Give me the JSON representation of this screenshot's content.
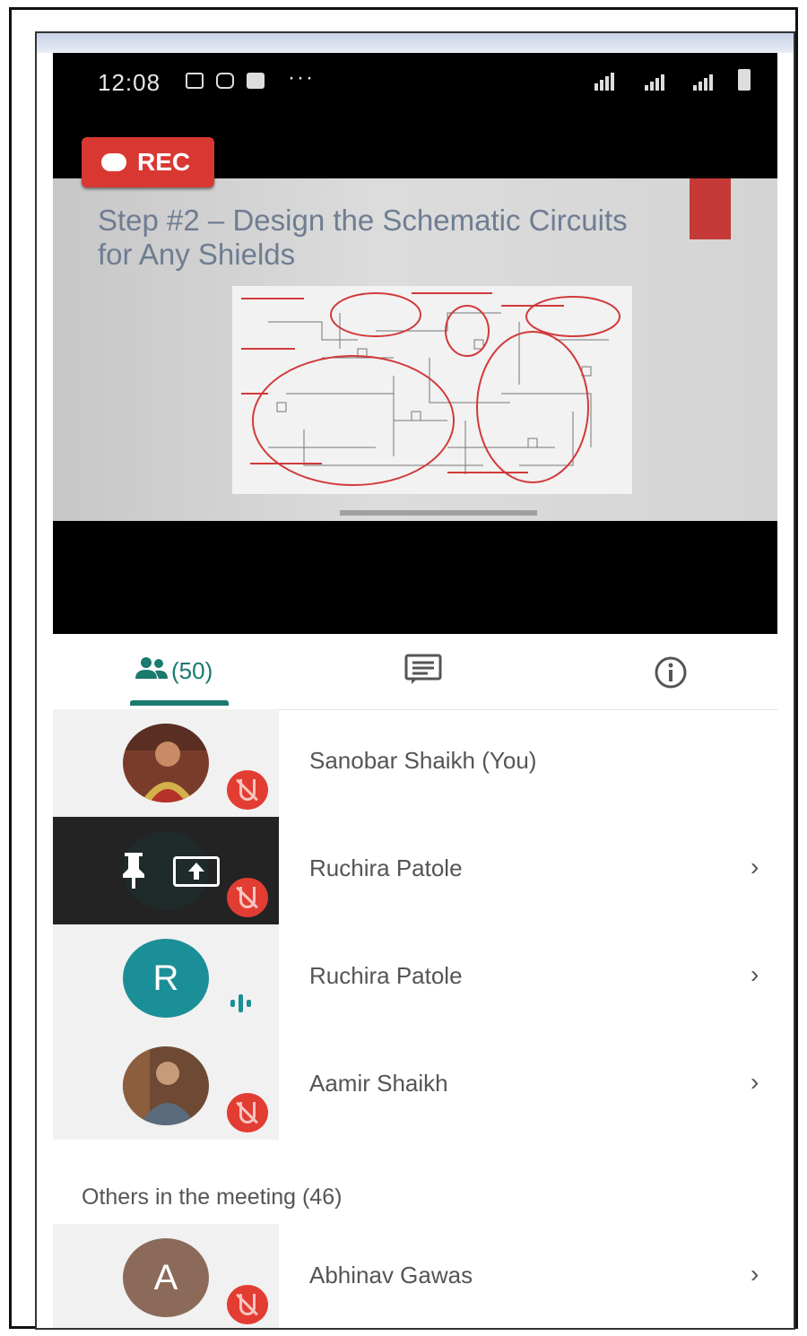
{
  "statusbar": {
    "time": "12:08",
    "dots": "···"
  },
  "video": {
    "rec_label": "REC",
    "slide_title": "Step #2 – Design the Schematic Circuits for Any Shields"
  },
  "tabs": {
    "people_count": "(50)"
  },
  "participants": [
    {
      "name": "Sanobar Shaikh (You)",
      "avatar": "photo",
      "status": "muted",
      "avatar_color": "#6b3a2a"
    },
    {
      "name": "Ruchira Patole",
      "avatar": "presenting",
      "status": "muted",
      "avatar_color": "#1f2a2a"
    },
    {
      "name": "Ruchira Patole",
      "avatar": "letter",
      "letter": "R",
      "status": "speaking",
      "avatar_color": "#1a8f97"
    },
    {
      "name": "Aamir Shaikh",
      "avatar": "photo",
      "status": "muted",
      "avatar_color": "#5a4a3a"
    }
  ],
  "others": {
    "label": "Others in the meeting (46)",
    "participants": [
      {
        "name": "Abhinav Gawas",
        "letter": "A",
        "status": "muted",
        "avatar_color": "#8b6a5a"
      }
    ]
  },
  "chevron": "›",
  "colors": {
    "accent": "#1a7a6e",
    "rec": "#d93832",
    "mute": "#e23d33"
  }
}
